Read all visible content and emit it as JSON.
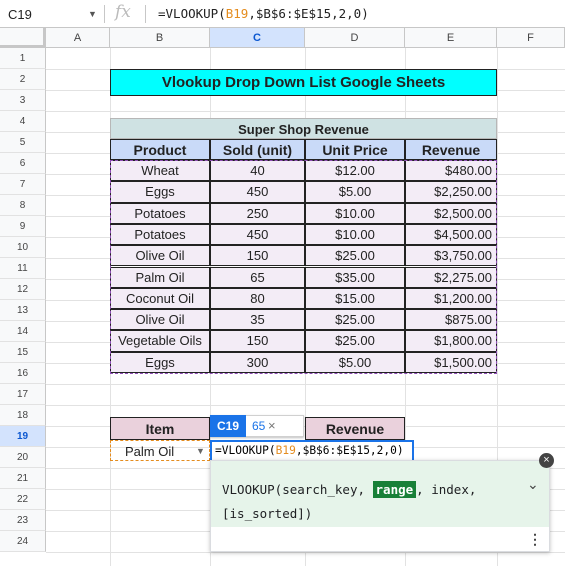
{
  "formula_bar": {
    "name_box": "C19",
    "fx_icon": "fx-icon",
    "formula_prefix": "=VLOOKUP(",
    "formula_ref": "B19",
    "formula_rest": ",$B$6:$E$15,2,0)"
  },
  "columns": [
    "A",
    "B",
    "C",
    "D",
    "E",
    "F"
  ],
  "rows": [
    "1",
    "2",
    "3",
    "4",
    "5",
    "6",
    "7",
    "8",
    "9",
    "10",
    "11",
    "12",
    "13",
    "14",
    "15",
    "16",
    "17",
    "18",
    "19",
    "20",
    "21",
    "22",
    "23",
    "24"
  ],
  "title": "Vlookup Drop Down List Google Sheets",
  "table": {
    "caption": "Super Shop Revenue",
    "headers": [
      "Product",
      "Sold (unit)",
      "Unit Price",
      "Revenue"
    ],
    "rows": [
      [
        "Wheat",
        "40",
        "$12.00",
        "$480.00"
      ],
      [
        "Eggs",
        "450",
        "$5.00",
        "$2,250.00"
      ],
      [
        "Potatoes",
        "250",
        "$10.00",
        "$2,500.00"
      ],
      [
        "Potatoes",
        "450",
        "$10.00",
        "$4,500.00"
      ],
      [
        "Olive Oil",
        "150",
        "$25.00",
        "$3,750.00"
      ],
      [
        "Palm Oil",
        "65",
        "$35.00",
        "$2,275.00"
      ],
      [
        "Coconut Oil",
        "80",
        "$15.00",
        "$1,200.00"
      ],
      [
        "Olive Oil",
        "35",
        "$25.00",
        "$875.00"
      ],
      [
        "Vegetable Oils",
        "150",
        "$25.00",
        "$1,800.00"
      ],
      [
        "Eggs",
        "300",
        "$5.00",
        "$1,500.00"
      ]
    ]
  },
  "lookup": {
    "item_header": "Item",
    "revenue_header": "Revenue",
    "item_value": "Palm Oil"
  },
  "chip": {
    "ref": "C19",
    "value": "65",
    "close": "×"
  },
  "editing": {
    "prefix": "=VLOOKUP(",
    "ref": "B19",
    "rest": ",$B$6:$E$15,2,0)"
  },
  "help": {
    "fn": "VLOOKUP(",
    "arg1": "search_key, ",
    "arg_active": "range",
    "arg3": ", index,",
    "arg4": "[is_sorted])",
    "close": "×",
    "chevron": "⌄",
    "kebab": "⋮"
  }
}
